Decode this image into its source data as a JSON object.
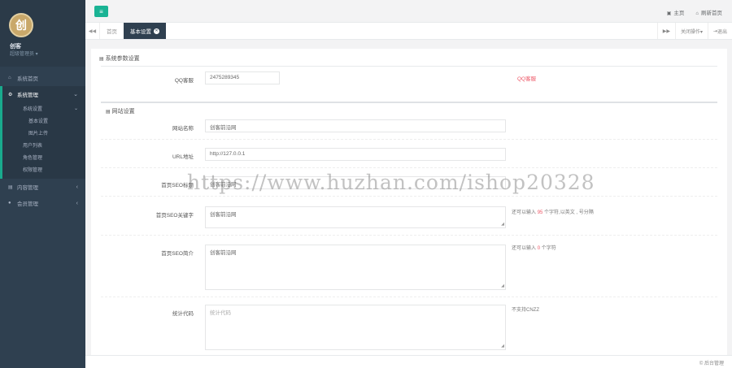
{
  "colors": {
    "sidebar": "#2f4050",
    "accent": "#1ab394",
    "danger": "#ed5565"
  },
  "profile": {
    "logo_glyph": "创",
    "name": "创客",
    "role": "超级管理员 ▾"
  },
  "nav": {
    "home": "系统首页",
    "system": "系统管理",
    "system_sub": "系统设置",
    "basic": "基本设置",
    "upload": "图片上传",
    "users": "用户列表",
    "roles": "角色管理",
    "perms": "权限管理",
    "content": "内容管理",
    "members": "会员管理"
  },
  "topbar": {
    "home": "主页",
    "refresh": "刷新首页",
    "menu_icon": "bars-icon"
  },
  "tabs": {
    "home": "首页",
    "current": "基本设置",
    "close_tabs": "关闭操作▾",
    "exit": "退出"
  },
  "form": {
    "section1": "系统参数设置",
    "qq_label": "QQ客服",
    "qq_value": "2475289345",
    "qq_hint": "QQ客服",
    "section2": "网站设置",
    "site_name_label": "网站名称",
    "site_name_value": "创客前沿网",
    "url_label": "URL地址",
    "url_value": "http://127.0.0.1",
    "seo_title_label": "首页SEO标题",
    "seo_title_value": "创客前沿网",
    "seo_kw_label": "首页SEO关键字",
    "seo_kw_value": "创客前沿网",
    "seo_kw_hint_a": "还可以输入",
    "seo_kw_hint_num": "95",
    "seo_kw_hint_b": "个字符,以英文 , 号分隔",
    "seo_desc_label": "首页SEO简介",
    "seo_desc_value": "创客前沿网",
    "seo_desc_hint_a": "还可以输入",
    "seo_desc_hint_num": "0",
    "seo_desc_hint_b": "个字符",
    "stats_label": "统计代码",
    "stats_placeholder": "统计代码",
    "stats_hint": "不支持CNZZ"
  },
  "footer": {
    "text": "© 后台管理"
  },
  "watermark": "https://www.huzhan.com/ishop20328"
}
